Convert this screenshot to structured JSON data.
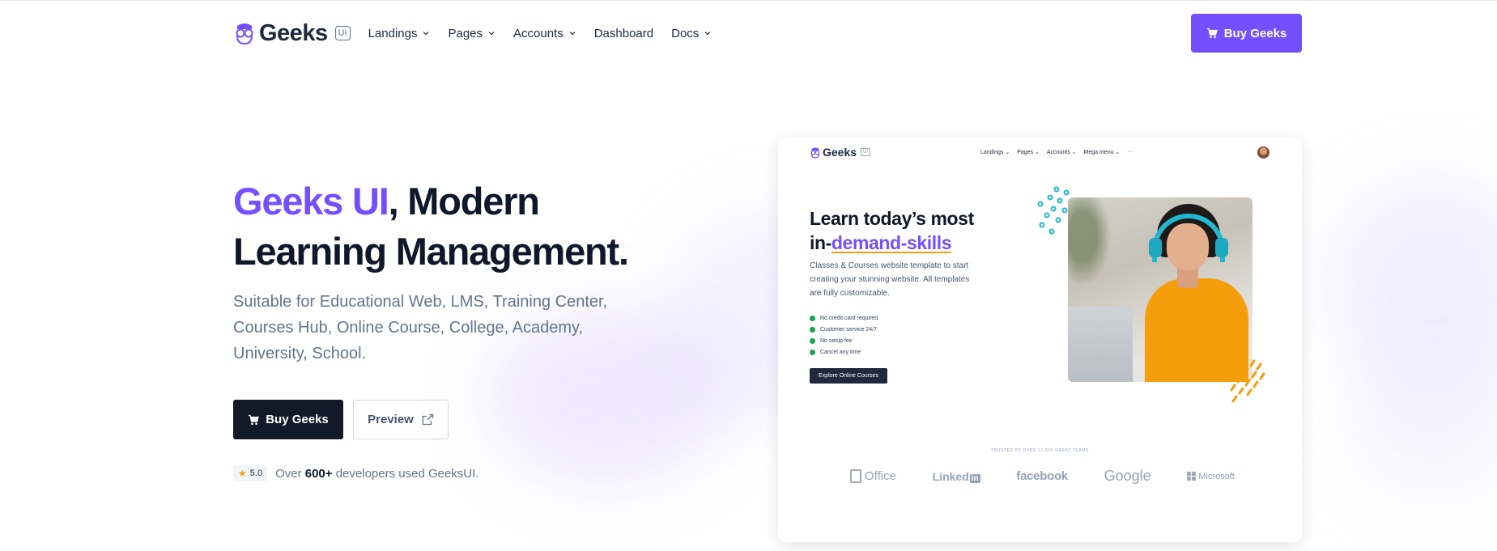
{
  "brand": {
    "name": "Geeks",
    "badge": "UI"
  },
  "nav": {
    "items": [
      {
        "label": "Landings",
        "dropdown": true
      },
      {
        "label": "Pages",
        "dropdown": true
      },
      {
        "label": "Accounts",
        "dropdown": true
      },
      {
        "label": "Dashboard",
        "dropdown": false
      },
      {
        "label": "Docs",
        "dropdown": true
      }
    ],
    "buy_label": "Buy Geeks"
  },
  "hero": {
    "title_accent": "Geeks UI",
    "title_rest": ", Modern Learning Management.",
    "subtitle": "Suitable for Educational Web, LMS, Training Center, Courses Hub, Online Course, College, Academy, University, School.",
    "buy_label": "Buy Geeks",
    "preview_label": "Preview",
    "rating": {
      "score": "5.0",
      "text_before": "Over ",
      "count": "600+",
      "text_after": " developers used GeeksUI."
    }
  },
  "preview": {
    "brand": "Geeks",
    "badge": "UI",
    "menu": [
      "Landings",
      "Pages",
      "Accounts",
      "Mega menu"
    ],
    "more": "···",
    "title_line1": "Learn today’s most",
    "title_prefix": "in-",
    "title_accent": "demand-skills",
    "description": "Classes & Courses website template to start creating your stunning website. All templates are fully customizable.",
    "features": [
      "No credit card required",
      "Customer service 24/7",
      "No setup fee",
      "Cancel any time"
    ],
    "cta": "Explore Online Courses",
    "trusted": "TRUSTED BY OVER 12,500 GREAT TEAMS",
    "logos": {
      "office": "Office",
      "linkedin": "Linked",
      "linkedin_box": "in",
      "facebook": "facebook",
      "google": "Google",
      "microsoft": "Microsoft"
    }
  },
  "colors": {
    "accent": "#754ffe",
    "dark": "#111827",
    "muted": "#64748b",
    "star": "#f59e0b"
  }
}
